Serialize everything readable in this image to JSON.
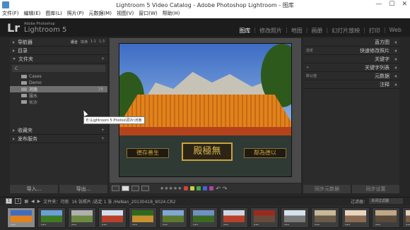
{
  "window": {
    "title": "Lightroom 5 Video Catalog - Adobe Photoshop Lightroom - 图库",
    "min": "—",
    "max": "☐",
    "close": "✕"
  },
  "menu": [
    "文件(F)",
    "编辑(E)",
    "图库(L)",
    "照片(P)",
    "元数据(M)",
    "视图(V)",
    "窗口(W)",
    "帮助(H)"
  ],
  "identity": {
    "logo": "Lr",
    "brand_small": "Adobe Photoshop",
    "brand_large": "Lightroom 5"
  },
  "modules": [
    "图库",
    "修改照片",
    "地图",
    "画册",
    "幻灯片放映",
    "打印",
    "Web"
  ],
  "active_module": "图库",
  "left": {
    "navigator": {
      "title": "导航器",
      "opts": [
        "适合",
        "填满",
        "1:1",
        "1:3"
      ]
    },
    "catalog": {
      "title": "目录"
    },
    "folders": {
      "title": "文件夹",
      "volume": "C",
      "items": [
        {
          "name": "Cases",
          "count": "",
          "indent": 1
        },
        {
          "name": "Demo",
          "count": "",
          "indent": 1
        },
        {
          "name": "河南",
          "count": "16",
          "indent": 1,
          "selected": true
        },
        {
          "name": "服水",
          "count": "",
          "indent": 1
        },
        {
          "name": "长沙",
          "count": "",
          "indent": 1
        }
      ]
    },
    "tooltip": "E:\\Lightroom 5 Photos\\原片\\河南",
    "collections": {
      "title": "收藏夹"
    },
    "publish": {
      "title": "发布服务"
    },
    "import_btn": "导入...",
    "export_btn": "导出..."
  },
  "right": {
    "histogram": "直方图",
    "quick_develop": "快速修改照片",
    "keywording": "关键字",
    "keyword_list": "关键字列表",
    "metadata": "元数据",
    "comments": "注释",
    "qd_label": "自定",
    "md_label": "默认值",
    "sync_meta": "同步元数据",
    "sync_settings": "同步设置"
  },
  "photo": {
    "plaque": "殿極無",
    "left_sign": "德存善生",
    "right_sign": "鄰為德以"
  },
  "toolbar": {
    "stars": "★★★★★",
    "rotate": "↶ ↷"
  },
  "filmstrip": {
    "monitors": [
      "1",
      "2"
    ],
    "path": "文件夹：河南",
    "info": "16 张照片 /选定 1 张 /HeNan_20130418_9024.CR2",
    "filter_label": "过滤器：",
    "filter_value": "关闭过滤器",
    "thumbs": [
      {
        "colors": [
          "#3d6cc4",
          "#e0831c"
        ],
        "selected": true
      },
      {
        "colors": [
          "#6aa0d8",
          "#3d7a22"
        ]
      },
      {
        "colors": [
          "#b0b0b0",
          "#6b8a40"
        ]
      },
      {
        "colors": [
          "#d2e0ee",
          "#b8402a"
        ]
      },
      {
        "colors": [
          "#2e6a1e",
          "#c89030"
        ]
      },
      {
        "colors": [
          "#7fa8d8",
          "#5c7a2e"
        ]
      },
      {
        "colors": [
          "#6f92c2",
          "#3a6a22"
        ]
      },
      {
        "colors": [
          "#cfd8e2",
          "#b8402a"
        ]
      },
      {
        "colors": [
          "#9a2a20",
          "#6a4a3a"
        ]
      },
      {
        "colors": [
          "#d8e2ec",
          "#7a7a7a"
        ]
      },
      {
        "colors": [
          "#c9b898",
          "#6a5a48"
        ]
      },
      {
        "colors": [
          "#e8d6c0",
          "#8a6a50"
        ]
      },
      {
        "colors": [
          "#bfa888",
          "#5a4a38"
        ]
      },
      {
        "colors": [
          "#e2d2bc",
          "#7a5a40"
        ]
      }
    ]
  }
}
